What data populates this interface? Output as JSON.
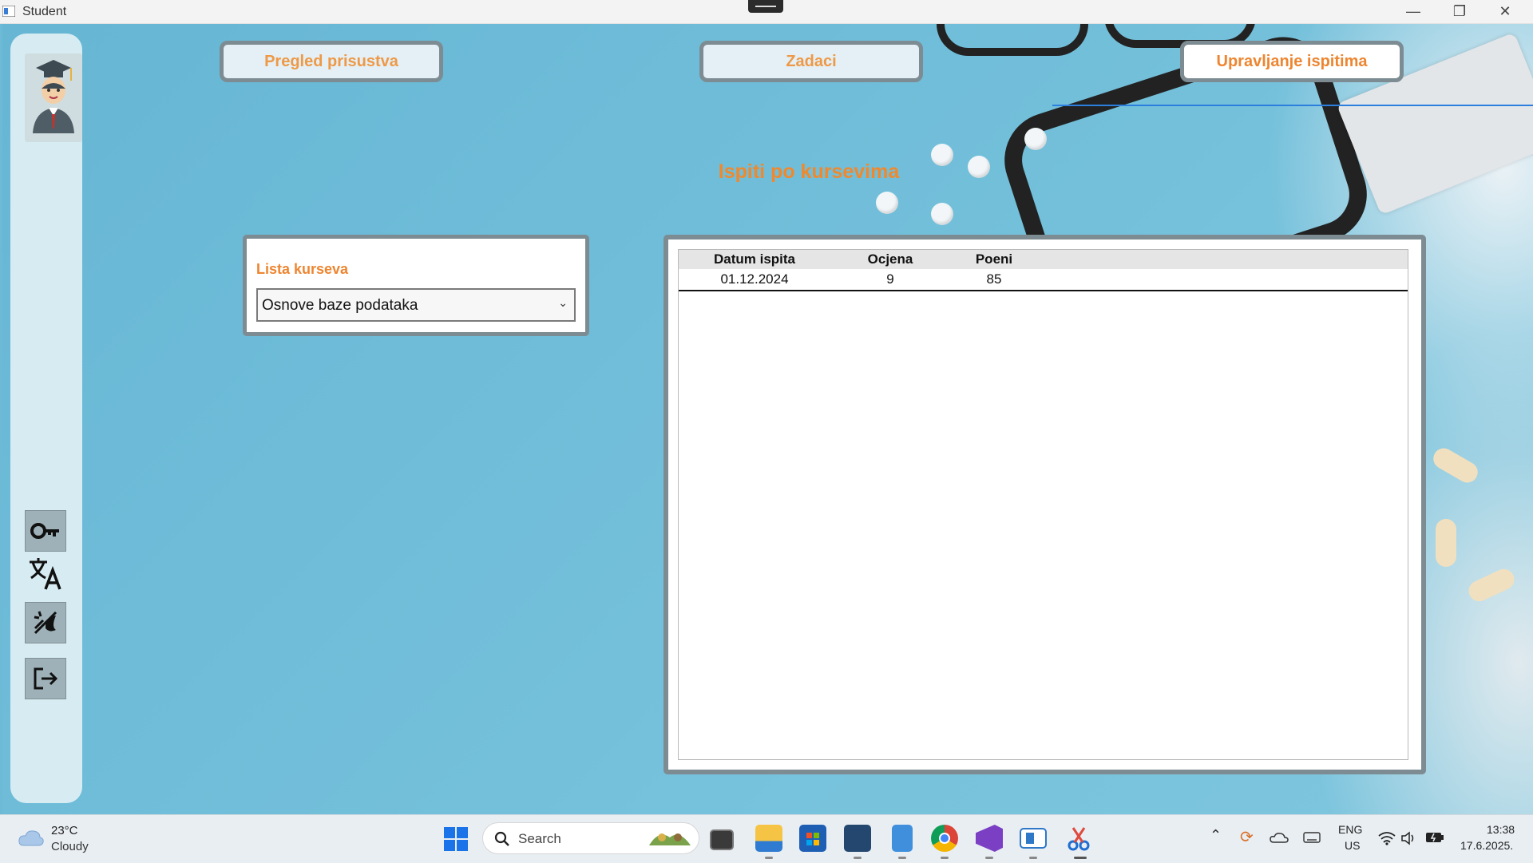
{
  "window": {
    "title": "Student",
    "controls": {
      "minimize": "—",
      "maximize": "❐",
      "close": "✕"
    }
  },
  "nav": {
    "attendance": "Pregled prisustva",
    "tasks": "Zadaci",
    "exams": "Upravljanje ispitima"
  },
  "page": {
    "title": "Ispiti po kursevima"
  },
  "course_panel": {
    "label": "Lista kurseva",
    "selected": "Osnove baze podataka"
  },
  "exams_table": {
    "columns": [
      "Datum ispita",
      "Ocjena",
      "Poeni"
    ],
    "rows": [
      {
        "date": "01.12.2024",
        "grade": "9",
        "points": "85"
      }
    ]
  },
  "taskbar": {
    "weather": {
      "temp": "23°C",
      "desc": "Cloudy"
    },
    "search_placeholder": "Search",
    "language": {
      "line1": "ENG",
      "line2": "US"
    },
    "clock": {
      "time": "13:38",
      "date": "17.6.2025."
    }
  },
  "icons": {
    "sidebar": [
      "student-avatar-icon",
      "key-icon",
      "translate-icon",
      "theme-toggle-icon",
      "logout-icon"
    ],
    "taskbar": [
      "weather-cloud-icon",
      "windows-start-icon",
      "search-icon",
      "terminal-icon",
      "file-explorer-icon",
      "microsoft-store-icon",
      "sql-server-icon",
      "notepad-icon",
      "chrome-icon",
      "visual-studio-icon",
      "remote-desktop-icon",
      "snipping-tool-icon",
      "chevron-up-icon",
      "sync-icon",
      "onedrive-icon",
      "keyboard-icon",
      "wifi-icon",
      "speaker-icon",
      "battery-icon"
    ]
  },
  "colors": {
    "accent_orange": "#EE8530",
    "panel_border": "#7D8C92",
    "nav_underline": "#2D7FDE"
  }
}
